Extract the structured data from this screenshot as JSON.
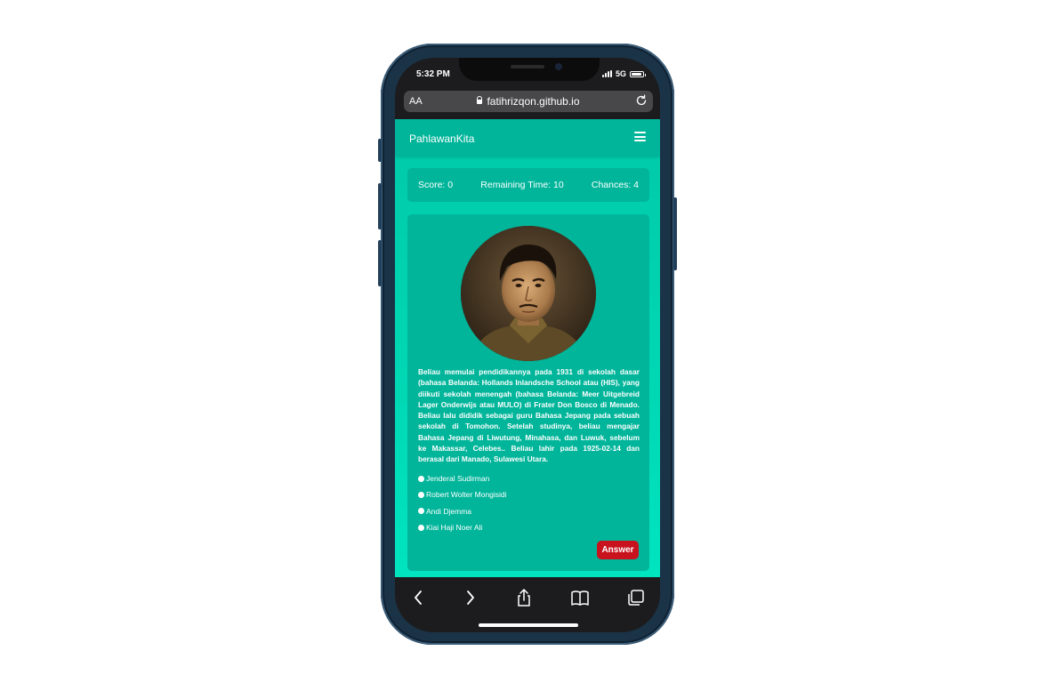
{
  "status_bar": {
    "time": "5:32 PM",
    "network": "5G"
  },
  "browser": {
    "text_size_label": "AA",
    "url": "fatihrizqon.github.io"
  },
  "navbar": {
    "brand": "PahlawanKita"
  },
  "stats": {
    "score": "Score: 0",
    "remaining_time": "Remaining Time: 10",
    "chances": "Chances: 4"
  },
  "question": {
    "description": "Beliau memulai pendidikannya pada 1931 di sekolah dasar (bahasa Belanda: Hollands Inlandsche School atau (HIS), yang diikuti sekolah menengah (bahasa Belanda: Meer Uitgebreid Lager Onderwijs atau MULO) di Frater Don Bosco di Menado. Beliau lalu dididik sebagai guru Bahasa Jepang pada sebuah sekolah di Tomohon. Setelah studinya, beliau mengajar Bahasa Jepang di Liwutung, Minahasa, dan Luwuk, sebelum ke Makassar, Celebes.. Beliau lahir pada 1925-02-14 dan berasal dari Manado, Sulawesi Utara.",
    "options": [
      {
        "label": "Jenderal Sudirman"
      },
      {
        "label": "Robert Wolter Mongisidi"
      },
      {
        "label": "Andi Djemma"
      },
      {
        "label": "Kiai Haji Noer Ali"
      }
    ],
    "answer_label": "Answer"
  },
  "colors": {
    "page_bg": "#00d8b4",
    "panel_bg": "#00b59a",
    "answer_button": "#c8131e",
    "browser_chrome": "#1c1c1e"
  },
  "icons": {
    "menu": "hamburger-menu-icon",
    "reload": "reload-icon",
    "lock": "lock-icon",
    "back": "chevron-left-icon",
    "forward": "chevron-right-icon",
    "share": "share-icon",
    "bookmarks": "book-icon",
    "tabs": "tabs-icon"
  }
}
